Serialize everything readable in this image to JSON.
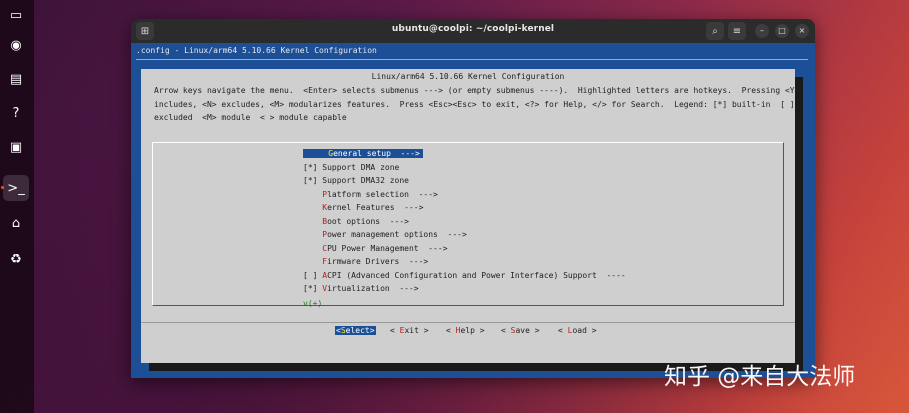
{
  "dock": {
    "items": [
      {
        "name": "files",
        "glyph": "▭"
      },
      {
        "name": "rhythmbox",
        "glyph": "◉"
      },
      {
        "name": "writer",
        "glyph": "▤"
      },
      {
        "name": "help",
        "glyph": "?"
      },
      {
        "name": "remote-desktop",
        "glyph": "▣"
      },
      {
        "name": "terminal",
        "glyph": ">_"
      },
      {
        "name": "usb",
        "glyph": "⌂"
      },
      {
        "name": "trash",
        "glyph": "♻"
      }
    ]
  },
  "window": {
    "title": "ubuntu@coolpi: ~/coolpi-kernel"
  },
  "terminal": {
    "config_path": ".config - Linux/arm64 5.10.66 Kernel Configuration",
    "dialog_title": "Linux/arm64 5.10.66 Kernel Configuration",
    "help_lines": [
      "Arrow keys navigate the menu.  <Enter> selects submenus ---> (or empty submenus ----).  Highlighted letters are hotkeys.  Pressing <Y>",
      "includes, <N> excludes, <M> modularizes features.  Press <Esc><Esc> to exit, <?> for Help, </> for Search.  Legend: [*] built-in  [ ]",
      "excluded  <M> module  < > module capable"
    ],
    "menu_items": [
      {
        "prefix": "    ",
        "hotkey": "G",
        "rest": "eneral setup  --->",
        "selected": true
      },
      {
        "prefix": "[*] ",
        "hotkey": "",
        "rest": "Support DMA zone",
        "selected": false
      },
      {
        "prefix": "[*] ",
        "hotkey": "",
        "rest": "Support DMA32 zone",
        "selected": false
      },
      {
        "prefix": "    ",
        "hotkey": "P",
        "rest": "latform selection  --->",
        "selected": false
      },
      {
        "prefix": "    ",
        "hotkey": "K",
        "rest": "ernel Features  --->",
        "selected": false
      },
      {
        "prefix": "    ",
        "hotkey": "B",
        "rest": "oot options  --->",
        "selected": false
      },
      {
        "prefix": "    ",
        "hotkey": "P",
        "rest": "ower management options  --->",
        "selected": false
      },
      {
        "prefix": "    ",
        "hotkey": "C",
        "rest": "PU Power Management  --->",
        "selected": false
      },
      {
        "prefix": "    ",
        "hotkey": "F",
        "rest": "irmware Drivers  --->",
        "selected": false
      },
      {
        "prefix": "[ ] ",
        "hotkey": "A",
        "rest": "CPI (Advanced Configuration and Power Interface) Support  ----",
        "selected": false
      },
      {
        "prefix": "[*] ",
        "hotkey": "V",
        "rest": "irtualization  --->",
        "selected": false
      }
    ],
    "more_indicator": "v(+)",
    "buttons": [
      {
        "open": "<",
        "hotkey": "S",
        "rest": "elect",
        "close": ">",
        "selected": true
      },
      {
        "open": "< ",
        "hotkey": "E",
        "rest": "xit",
        "close": " >",
        "selected": false
      },
      {
        "open": "< ",
        "hotkey": "H",
        "rest": "elp",
        "close": " >",
        "selected": false
      },
      {
        "open": "< ",
        "hotkey": "S",
        "rest": "ave",
        "close": " >",
        "selected": false
      },
      {
        "open": "< ",
        "hotkey": "L",
        "rest": "oad",
        "close": " >",
        "selected": false
      }
    ]
  },
  "watermark": "知乎 @来自大法师",
  "colors": {
    "terminal_bg": "#1d4f96",
    "dialog_bg": "#cfcfcf",
    "hotkey": "#b71c1c",
    "selected_hotkey": "#ffeb3b",
    "more_indicator": "#1b7a1b"
  }
}
